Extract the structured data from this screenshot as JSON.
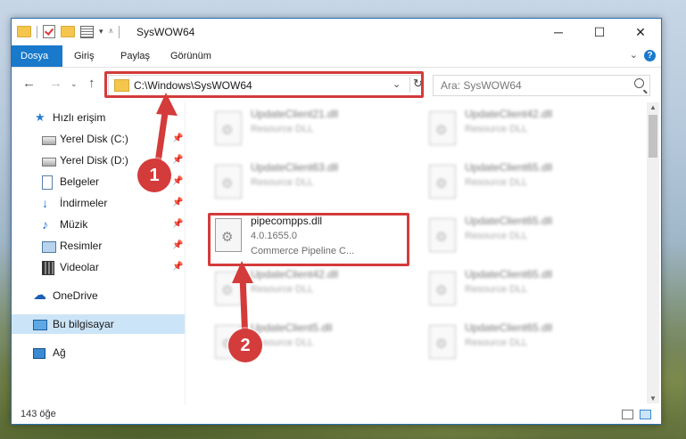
{
  "window": {
    "title": "SysWOW64"
  },
  "ribbon": {
    "tabs": [
      "Dosya",
      "Giriş",
      "Paylaş",
      "Görünüm"
    ]
  },
  "address": {
    "path": "C:\\Windows\\SysWOW64"
  },
  "search": {
    "placeholder": "Ara: SysWOW64"
  },
  "sidebar": {
    "quick_access": "Hızlı erişim",
    "items": [
      {
        "label": "Yerel Disk (C:)",
        "icon": "disk-icon"
      },
      {
        "label": "Yerel Disk (D:)",
        "icon": "disk-icon"
      },
      {
        "label": "Belgeler",
        "icon": "documents-icon"
      },
      {
        "label": "İndirmeler",
        "icon": "download-icon"
      },
      {
        "label": "Müzik",
        "icon": "music-icon"
      },
      {
        "label": "Resimler",
        "icon": "pictures-icon"
      },
      {
        "label": "Videolar",
        "icon": "videos-icon"
      }
    ],
    "onedrive": "OneDrive",
    "this_pc": "Bu bilgisayar",
    "network": "Ağ"
  },
  "files": [
    {
      "name": "UpdateClient21.dll",
      "type": "Resource DLL"
    },
    {
      "name": "UpdateClient42.dll",
      "type": "Resource DLL"
    },
    {
      "name": "UpdateClient63.dll",
      "type": "Resource DLL"
    },
    {
      "name": "UpdateClient65.dll",
      "type": "Resource DLL"
    },
    {
      "name": "pipecompps.dll",
      "version": "4.0.1655.0",
      "type": "Commerce Pipeline C..."
    },
    {
      "name": "UpdateClient65.dll",
      "type": "Resource DLL"
    },
    {
      "name": "UpdateClient42.dll",
      "type": "Resource DLL"
    },
    {
      "name": "UpdateClient65.dll",
      "type": "Resource DLL"
    },
    {
      "name": "UpdateClient5.dll",
      "type": "Resource DLL"
    },
    {
      "name": "UpdateClient65.dll",
      "type": "Resource DLL"
    }
  ],
  "status": {
    "count": "143 öğe"
  },
  "annotations": {
    "step1": "1",
    "step2": "2"
  },
  "colors": {
    "accent": "#1979ca",
    "highlight": "#d43b3b"
  }
}
